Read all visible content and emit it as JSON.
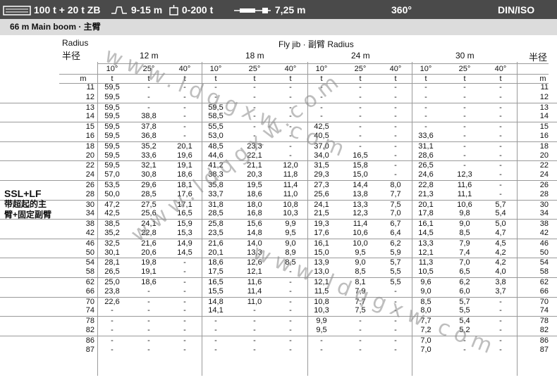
{
  "header": {
    "counterweight": "100 t + 20 t ZB",
    "outrigger_base": "9-15 m",
    "superlift": "0-200 t",
    "boom_base": "7,25 m",
    "slew": "360°",
    "standard": "DIN/ISO"
  },
  "config": {
    "label": "66 m  Main boom · 主臂"
  },
  "labels": {
    "radius_en": "Radius",
    "radius_cn": "半径",
    "radius_cn_right": "半径",
    "jib": "Fly jib ·  副臂 Radius",
    "left_line1": "SSL+LF",
    "left_line2": "带超起的主",
    "left_line3": "臂+固定副臂",
    "unit_m": "m",
    "unit_t": "t"
  },
  "groups": [
    {
      "jib_length": "12 m",
      "angles": [
        "10°",
        "25°",
        "40°"
      ]
    },
    {
      "jib_length": "18 m",
      "angles": [
        "10°",
        "25°",
        "40°"
      ]
    },
    {
      "jib_length": "24 m",
      "angles": [
        "10°",
        "25°",
        "40°"
      ]
    },
    {
      "jib_length": "30 m",
      "angles": [
        "10°",
        "25°",
        "40°"
      ]
    }
  ],
  "watermark": "www.ldqgxw.com",
  "rows": [
    {
      "r": "11",
      "v": [
        "59,5",
        "-",
        "-",
        "-",
        "-",
        "-",
        "-",
        "-",
        "-",
        "-",
        "-",
        "-"
      ]
    },
    {
      "r": "12",
      "v": [
        "59,5",
        "-",
        "-",
        "-",
        "-",
        "-",
        "-",
        "-",
        "-",
        "-",
        "-",
        "-"
      ]
    },
    {
      "r": "13",
      "v": [
        "59,5",
        "-",
        "-",
        "59,5",
        "-",
        "-",
        "-",
        "-",
        "-",
        "-",
        "-",
        "-"
      ]
    },
    {
      "r": "14",
      "v": [
        "59,5",
        "38,8",
        "-",
        "58,5",
        "-",
        "-",
        "-",
        "-",
        "-",
        "-",
        "-",
        "-"
      ]
    },
    {
      "r": "15",
      "v": [
        "59,5",
        "37,8",
        "-",
        "55,5",
        "-",
        "-",
        "42,5",
        "-",
        "-",
        "-",
        "-",
        "-"
      ]
    },
    {
      "r": "16",
      "v": [
        "59,5",
        "36,8",
        "-",
        "53,0",
        "-",
        "-",
        "40,5",
        "-",
        "-",
        "33,6",
        "-",
        "-"
      ]
    },
    {
      "r": "18",
      "v": [
        "59,5",
        "35,2",
        "20,1",
        "48,5",
        "23,3",
        "-",
        "37,0",
        "-",
        "-",
        "31,1",
        "-",
        "-"
      ]
    },
    {
      "r": "20",
      "v": [
        "59,5",
        "33,6",
        "19,6",
        "44,6",
        "22,1",
        "-",
        "34,0",
        "16,5",
        "-",
        "28,6",
        "-",
        "-"
      ]
    },
    {
      "r": "22",
      "v": [
        "59,5",
        "32,1",
        "19,1",
        "41,2",
        "21,1",
        "12,0",
        "31,5",
        "15,8",
        "-",
        "26,5",
        "-",
        "-"
      ]
    },
    {
      "r": "24",
      "v": [
        "57,0",
        "30,8",
        "18,6",
        "38,3",
        "20,3",
        "11,8",
        "29,3",
        "15,0",
        "-",
        "24,6",
        "12,3",
        "-"
      ]
    },
    {
      "r": "26",
      "v": [
        "53,5",
        "29,6",
        "18,1",
        "35,8",
        "19,5",
        "11,4",
        "27,3",
        "14,4",
        "8,0",
        "22,8",
        "11,6",
        "-"
      ]
    },
    {
      "r": "28",
      "v": [
        "50,0",
        "28,5",
        "17,6",
        "33,7",
        "18,6",
        "11,0",
        "25,6",
        "13,8",
        "7,7",
        "21,3",
        "11,1",
        "-"
      ]
    },
    {
      "r": "30",
      "v": [
        "47,2",
        "27,5",
        "17,1",
        "31,8",
        "18,0",
        "10,8",
        "24,1",
        "13,3",
        "7,5",
        "20,1",
        "10,6",
        "5,7"
      ]
    },
    {
      "r": "34",
      "v": [
        "42,5",
        "25,6",
        "16,5",
        "28,5",
        "16,8",
        "10,3",
        "21,5",
        "12,3",
        "7,0",
        "17,8",
        "9,8",
        "5,4"
      ]
    },
    {
      "r": "38",
      "v": [
        "38,5",
        "24,1",
        "15,9",
        "25,8",
        "15,6",
        "9,9",
        "19,3",
        "11,4",
        "6,7",
        "16,1",
        "9,0",
        "5,0"
      ]
    },
    {
      "r": "42",
      "v": [
        "35,2",
        "22,8",
        "15,3",
        "23,5",
        "14,8",
        "9,5",
        "17,6",
        "10,6",
        "6,4",
        "14,5",
        "8,5",
        "4,7"
      ]
    },
    {
      "r": "46",
      "v": [
        "32,5",
        "21,6",
        "14,9",
        "21,6",
        "14,0",
        "9,0",
        "16,1",
        "10,0",
        "6,2",
        "13,3",
        "7,9",
        "4,5"
      ]
    },
    {
      "r": "50",
      "v": [
        "30,1",
        "20,6",
        "14,5",
        "20,1",
        "13,3",
        "8,9",
        "15,0",
        "9,5",
        "5,9",
        "12,1",
        "7,4",
        "4,2"
      ]
    },
    {
      "r": "54",
      "v": [
        "28,1",
        "19,8",
        "-",
        "18,6",
        "12,6",
        "8,5",
        "13,9",
        "9,0",
        "5,7",
        "11,3",
        "7,0",
        "4,2"
      ]
    },
    {
      "r": "58",
      "v": [
        "26,5",
        "19,1",
        "-",
        "17,5",
        "12,1",
        "-",
        "13,0",
        "8,5",
        "5,5",
        "10,5",
        "6,5",
        "4,0"
      ]
    },
    {
      "r": "62",
      "v": [
        "25,0",
        "18,6",
        "-",
        "16,5",
        "11,6",
        "-",
        "12,1",
        "8,1",
        "5,5",
        "9,6",
        "6,2",
        "3,8"
      ]
    },
    {
      "r": "66",
      "v": [
        "23,8",
        "-",
        "-",
        "15,5",
        "11,4",
        "-",
        "11,5",
        "7,9",
        "-",
        "9,0",
        "6,0",
        "3,7"
      ]
    },
    {
      "r": "70",
      "v": [
        "22,6",
        "-",
        "-",
        "14,8",
        "11,0",
        "-",
        "10,8",
        "7,7",
        "-",
        "8,5",
        "5,7",
        "-"
      ]
    },
    {
      "r": "74",
      "v": [
        "-",
        "-",
        "-",
        "14,1",
        "-",
        "-",
        "10,3",
        "7,5",
        "-",
        "8,0",
        "5,5",
        "-"
      ]
    },
    {
      "r": "78",
      "v": [
        "-",
        "-",
        "-",
        "-",
        "-",
        "-",
        "9,9",
        "-",
        "-",
        "7,7",
        "5,4",
        "-"
      ]
    },
    {
      "r": "82",
      "v": [
        "-",
        "-",
        "-",
        "-",
        "-",
        "-",
        "9,5",
        "-",
        "-",
        "7,2",
        "5,2",
        "-"
      ]
    },
    {
      "r": "86",
      "v": [
        "-",
        "-",
        "-",
        "-",
        "-",
        "-",
        "-",
        "-",
        "-",
        "7,0",
        "-",
        "-"
      ]
    },
    {
      "r": "87",
      "v": [
        "-",
        "-",
        "-",
        "-",
        "-",
        "-",
        "-",
        "-",
        "-",
        "7,0",
        "-",
        "-"
      ]
    }
  ]
}
